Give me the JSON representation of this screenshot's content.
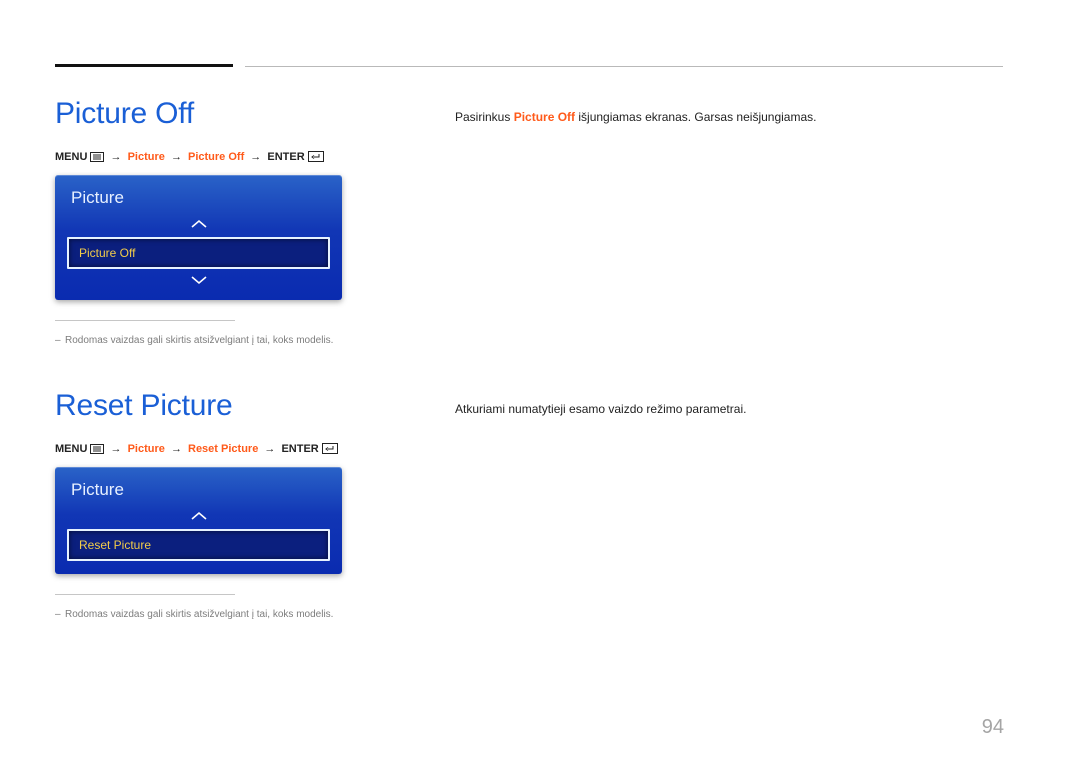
{
  "section1": {
    "heading": "Picture Off",
    "breadcrumb": {
      "menu": "MENU",
      "p1": "Picture",
      "p2": "Picture Off",
      "enter": "ENTER"
    },
    "panel": {
      "title": "Picture",
      "item": "Picture Off"
    },
    "note": "Rodomas vaizdas gali skirtis atsižvelgiant į tai, koks modelis.",
    "desc_pre": "Pasirinkus ",
    "desc_hl": "Picture Off",
    "desc_post": " išjungiamas ekranas. Garsas neišjungiamas."
  },
  "section2": {
    "heading": "Reset Picture",
    "breadcrumb": {
      "menu": "MENU",
      "p1": "Picture",
      "p2": "Reset Picture",
      "enter": "ENTER"
    },
    "panel": {
      "title": "Picture",
      "item": "Reset Picture"
    },
    "note": "Rodomas vaizdas gali skirtis atsižvelgiant į tai, koks modelis.",
    "desc": "Atkuriami numatytieji esamo vaizdo režimo parametrai."
  },
  "pageNumber": "94"
}
